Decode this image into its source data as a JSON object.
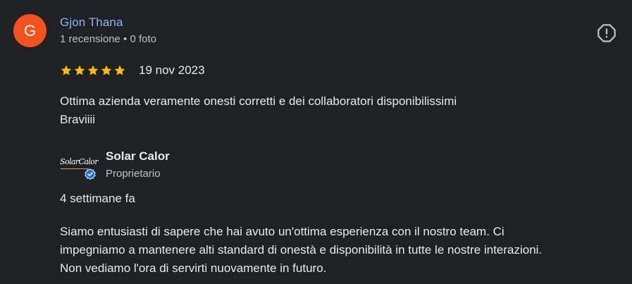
{
  "review": {
    "avatar_letter": "G",
    "avatar_color": "#f4511e",
    "reviewer_name": "Gjon Thana",
    "reviewer_meta": "1 recensione • 0 foto",
    "rating": 5,
    "max_rating": 5,
    "date": "19 nov 2023",
    "text_lines": [
      "Ottima azienda veramente onesti corretti e dei collaboratori disponibilissimi",
      "Braviiii"
    ],
    "report_icon": "report-flag-icon"
  },
  "owner_reply": {
    "logo_text": "SolarCalor",
    "owner_name": "Solar Calor",
    "owner_role": "Proprietario",
    "time": "4 settimane fa",
    "text_lines": [
      "Siamo entusiasti di sapere che hai avuto un'ottima esperienza con il nostro team. Ci",
      "impegniamo a mantenere alti standard di onestà e disponibilità in tutte le nostre interazioni.",
      "Non vediamo l'ora di servirti nuovamente in futuro."
    ],
    "verified_icon": "verified-check-icon"
  },
  "colors": {
    "background": "#202124",
    "link": "#8ab4f8",
    "star": "#fbbc04",
    "verified": "#1a73e8"
  }
}
